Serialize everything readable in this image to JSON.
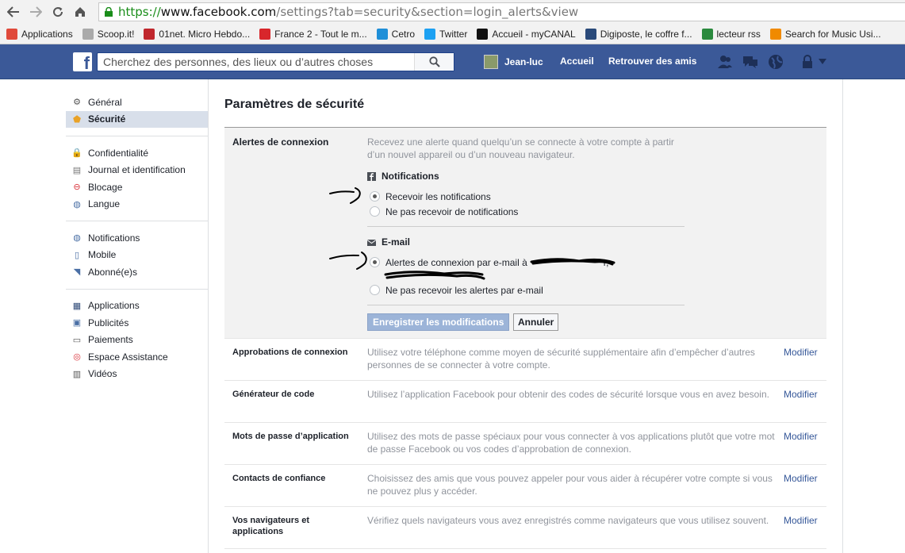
{
  "browser": {
    "url_scheme": "https://",
    "url_host": "www.facebook.com",
    "url_path": "/settings?tab=security&section=login_alerts&view",
    "bookmarks": [
      {
        "label": "Applications",
        "icon": "apps-grid-icon",
        "color": "#e04a3b"
      },
      {
        "label": "Scoop.it!",
        "icon": "document-icon",
        "color": "#aaaaaa"
      },
      {
        "label": "01net. Micro Hebdo...",
        "icon": "01net-icon",
        "color": "#c0272d"
      },
      {
        "label": "France 2 - Tout le m...",
        "icon": "france2-icon",
        "color": "#d8262b"
      },
      {
        "label": "Cetro",
        "icon": "cetro-icon",
        "color": "#1f8fd8"
      },
      {
        "label": "Twitter",
        "icon": "twitter-icon",
        "color": "#1da1f2"
      },
      {
        "label": "Accueil - myCANAL",
        "icon": "plus-icon",
        "color": "#111111"
      },
      {
        "label": "Digiposte, le coffre f...",
        "icon": "digiposte-icon",
        "color": "#2a4a7a"
      },
      {
        "label": "lecteur rss",
        "icon": "rss-reader-icon",
        "color": "#2b8a3e"
      },
      {
        "label": "Search for Music Usi...",
        "icon": "soundhound-icon",
        "color": "#f08a00"
      }
    ]
  },
  "fb_header": {
    "logo": "f",
    "search_placeholder": "Cherchez des personnes, des lieux ou d’autres choses",
    "user_name": "Jean-luc",
    "home": "Accueil",
    "find_friends": "Retrouver des amis",
    "brand_color": "#3b5998"
  },
  "sidebar": {
    "group1": [
      {
        "label": "Général",
        "icon": "gear-icon"
      },
      {
        "label": "Sécurité",
        "icon": "shield-icon",
        "active": true
      }
    ],
    "group2": [
      {
        "label": "Confidentialité",
        "icon": "lock-icon"
      },
      {
        "label": "Journal et identification",
        "icon": "timeline-icon"
      },
      {
        "label": "Blocage",
        "icon": "block-icon"
      },
      {
        "label": "Langue",
        "icon": "globe-icon"
      }
    ],
    "group3": [
      {
        "label": "Notifications",
        "icon": "globe-notifications-icon"
      },
      {
        "label": "Mobile",
        "icon": "mobile-icon"
      },
      {
        "label": "Abonné(e)s",
        "icon": "rss-icon"
      }
    ],
    "group4": [
      {
        "label": "Applications",
        "icon": "apps-icon"
      },
      {
        "label": "Publicités",
        "icon": "ads-icon"
      },
      {
        "label": "Paiements",
        "icon": "card-icon"
      },
      {
        "label": "Espace Assistance",
        "icon": "lifebuoy-icon"
      },
      {
        "label": "Vidéos",
        "icon": "film-icon"
      }
    ]
  },
  "main": {
    "title": "Paramètres de sécurité",
    "login_alerts": {
      "label": "Alertes de connexion",
      "desc": "Recevez une alerte quand quelqu’un se connecte à votre compte à partir d’un nouvel appareil ou d’un nouveau navigateur.",
      "notif_head": "Notifications",
      "notif_on": "Recevoir les notifications",
      "notif_off": "Ne pas recevoir de notifications",
      "email_head": "E-mail",
      "email_on": "Alertes de connexion par e-mail à",
      "email_on_tail": "r,",
      "email_off": "Ne pas recevoir les alertes par e-mail",
      "save": "Enregistrer les modifications",
      "cancel": "Annuler"
    },
    "rows": [
      {
        "label": "Approbations de connexion",
        "desc": "Utilisez votre téléphone comme moyen de sécurité supplémentaire afin d’empêcher d’autres personnes de se connecter à votre compte.",
        "edit": "Modifier"
      },
      {
        "label": "Générateur de code",
        "desc": "Utilisez l’application Facebook pour obtenir des codes de sécurité lorsque vous en avez besoin.",
        "edit": "Modifier"
      },
      {
        "label": "Mots de passe d’application",
        "desc": "Utilisez des mots de passe spéciaux pour vous connecter à vos applications plutôt que votre mot de passe Facebook ou vos codes d’approbation de connexion.",
        "edit": "Modifier"
      },
      {
        "label": "Contacts de confiance",
        "desc": "Choisissez des amis que vous pouvez appeler pour vous aider à récupérer votre compte si vous ne pouvez plus y accéder.",
        "edit": "Modifier"
      },
      {
        "label": "Vos navigateurs et applications",
        "desc": "Vérifiez quels navigateurs vous avez enregistrés comme navigateurs que vous utilisez souvent.",
        "edit": "Modifier"
      }
    ]
  }
}
